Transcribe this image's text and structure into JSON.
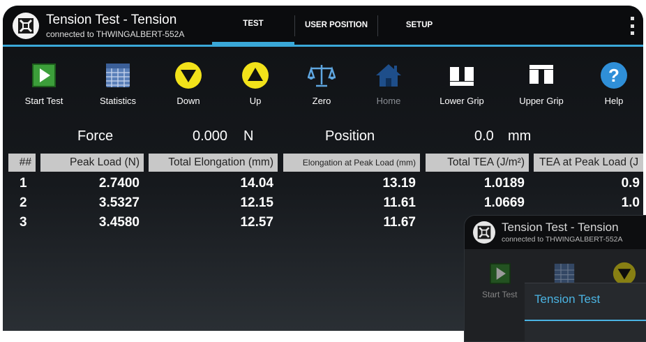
{
  "header": {
    "title": "Tension Test - Tension",
    "subtitle": "connected to THWINGALBERT-552A",
    "tabs": [
      {
        "label": "TEST",
        "active": true
      },
      {
        "label": "USER POSITION",
        "active": false
      },
      {
        "label": "SETUP",
        "active": false
      }
    ],
    "icons": {
      "logo": "thwing-albert-logo",
      "menu": "overflow-menu-icon"
    }
  },
  "toolbar": [
    {
      "label": "Start Test",
      "icon": "play-icon",
      "enabled": true
    },
    {
      "label": "Statistics",
      "icon": "statistics-grid-icon",
      "enabled": true
    },
    {
      "label": "Down",
      "icon": "down-arrow-icon",
      "enabled": true
    },
    {
      "label": "Up",
      "icon": "up-arrow-icon",
      "enabled": true
    },
    {
      "label": "Zero",
      "icon": "balance-scale-icon",
      "enabled": true
    },
    {
      "label": "Home",
      "icon": "home-icon",
      "enabled": false
    },
    {
      "label": "Lower Grip",
      "icon": "lower-grip-icon",
      "enabled": true
    },
    {
      "label": "Upper Grip",
      "icon": "upper-grip-icon",
      "enabled": true
    },
    {
      "label": "Help",
      "icon": "help-icon",
      "enabled": true
    }
  ],
  "readouts": {
    "force_label": "Force",
    "force_value": "0.000",
    "force_unit": "N",
    "position_label": "Position",
    "position_value": "0.0",
    "position_unit": "mm"
  },
  "table": {
    "columns": [
      "##",
      "Peak Load (N)",
      "Total Elongation (mm)",
      "Elongation at Peak Load (mm)",
      "Total TEA (J/m²)",
      "TEA at Peak Load (J"
    ],
    "rows": [
      [
        "1",
        "2.7400",
        "14.04",
        "13.19",
        "1.0189",
        "0.9"
      ],
      [
        "2",
        "3.5327",
        "12.15",
        "11.61",
        "1.0669",
        "1.0"
      ],
      [
        "3",
        "3.4580",
        "12.57",
        "11.67",
        "",
        ""
      ]
    ]
  },
  "overlay": {
    "title": "Tension Test - Tension",
    "subtitle": "connected to THWINGALBERT-552A",
    "start_label": "Start Test",
    "dialog_title": "Tension Test"
  },
  "colors": {
    "accent": "#3aa8d8",
    "dialog_accent": "#4bb4e3",
    "play_green": "#3c9e3a",
    "arrow_yellow": "#f2e21a",
    "help_blue": "#2f8fd8",
    "home_blue": "#1e4e8a"
  }
}
